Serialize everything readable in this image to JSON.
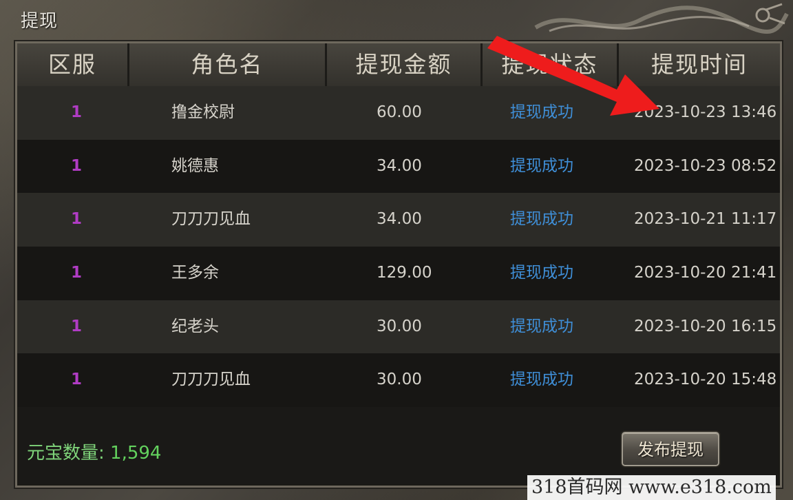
{
  "window": {
    "title": "提现"
  },
  "table": {
    "headers": [
      "区服",
      "角色名",
      "提现金额",
      "提现状态",
      "提现时间"
    ],
    "rows": [
      {
        "zone": "1",
        "name": "撸金校尉",
        "amount": "60.00",
        "status": "提现成功",
        "time": "2023-10-23 13:46"
      },
      {
        "zone": "1",
        "name": "姚德惠",
        "amount": "34.00",
        "status": "提现成功",
        "time": "2023-10-23 08:52"
      },
      {
        "zone": "1",
        "name": "刀刀刀见血",
        "amount": "34.00",
        "status": "提现成功",
        "time": "2023-10-21 11:17"
      },
      {
        "zone": "1",
        "name": "王多余",
        "amount": "129.00",
        "status": "提现成功",
        "time": "2023-10-20 21:41"
      },
      {
        "zone": "1",
        "name": "纪老头",
        "amount": "30.00",
        "status": "提现成功",
        "time": "2023-10-20 16:15"
      },
      {
        "zone": "1",
        "name": "刀刀刀见血",
        "amount": "30.00",
        "status": "提现成功",
        "time": "2023-10-20 15:48"
      }
    ]
  },
  "footer": {
    "balance_label": "元宝数量:",
    "balance_value": "1,594",
    "publish_button": "发布提现"
  },
  "overlay": {
    "watermark": "318首码网 www.e318.com"
  },
  "colors": {
    "zone": "#b03cc4",
    "status": "#3f8fd8",
    "balance": "#63d25e",
    "arrow": "#ee1c1c"
  },
  "icons": {
    "arrow": "red-arrow-icon",
    "dragon": "dragon-ornament-icon"
  }
}
